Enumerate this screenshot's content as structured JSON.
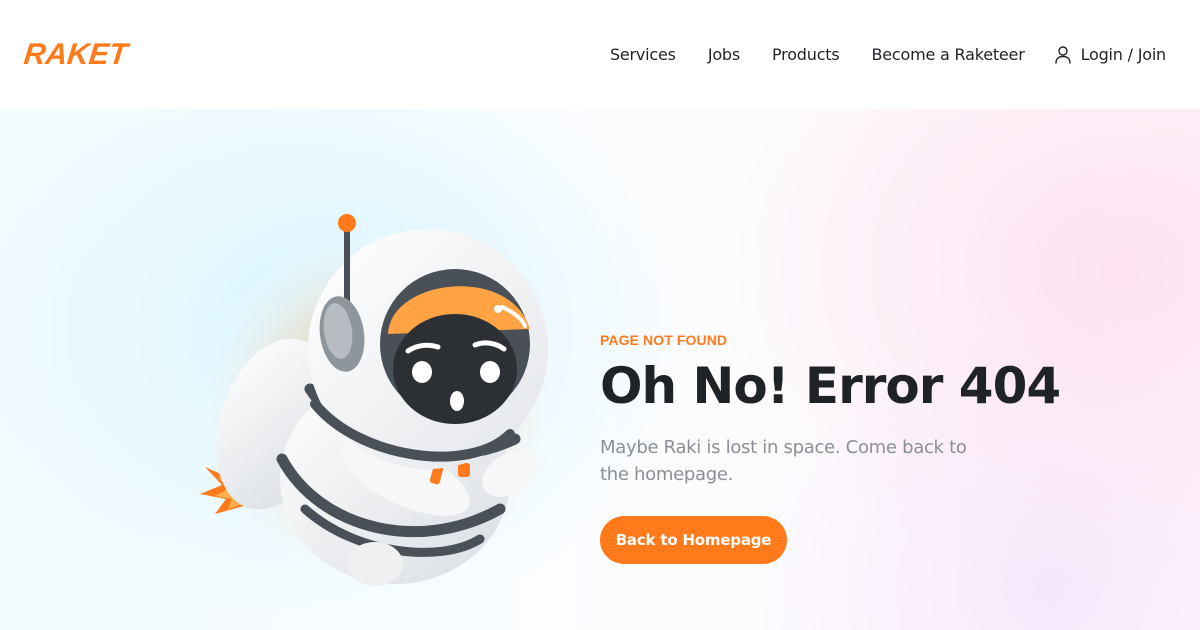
{
  "header": {
    "logo": "RAKET",
    "nav": [
      {
        "label": "Services"
      },
      {
        "label": "Jobs"
      },
      {
        "label": "Products"
      },
      {
        "label": "Become a Raketeer"
      }
    ],
    "login_label": "Login / Join",
    "login_icon": "user-icon"
  },
  "main": {
    "eyebrow": "PAGE NOT FOUND",
    "title": "Oh No! Error 404",
    "subtitle": "Maybe Raki is lost in space. Come back to the homepage.",
    "button_label": "Back to Homepage"
  },
  "colors": {
    "brand": "#ff7a1a",
    "text": "#1f2328",
    "muted": "#8a8f98"
  }
}
